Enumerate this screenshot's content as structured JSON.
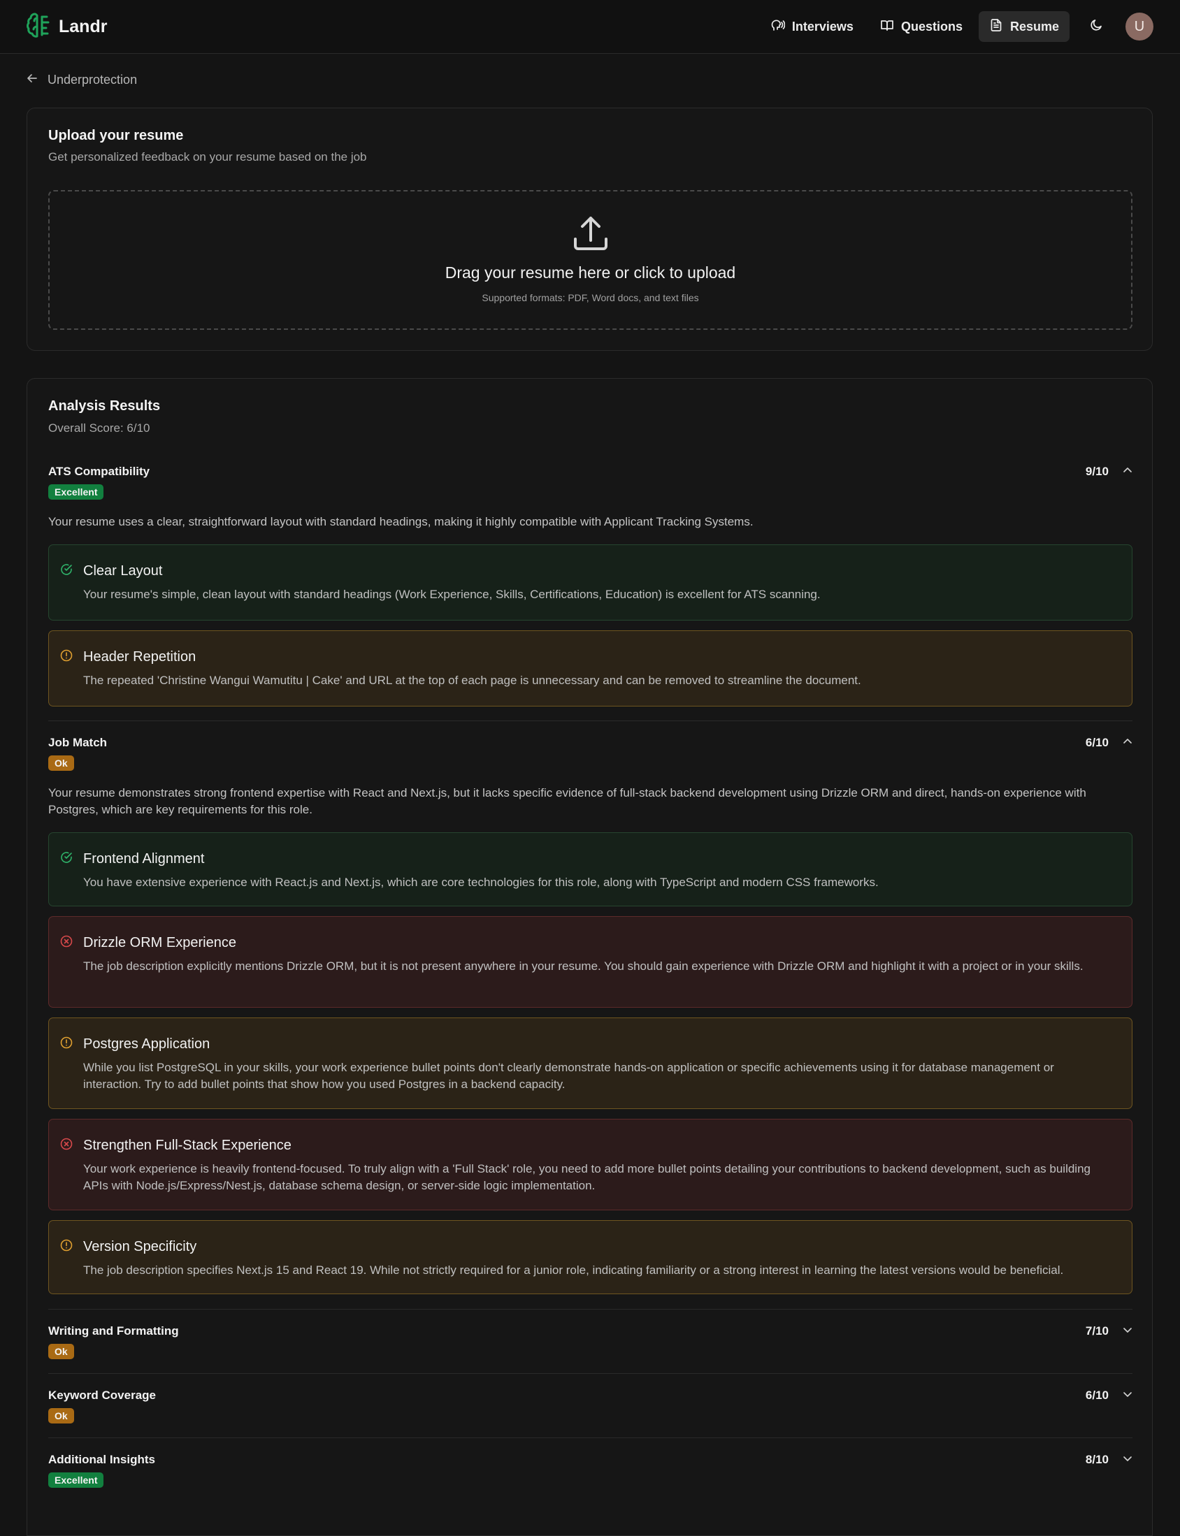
{
  "app": {
    "name": "Landr"
  },
  "nav": {
    "interviews": "Interviews",
    "questions": "Questions",
    "resume": "Resume",
    "avatar_initial": "U"
  },
  "back": {
    "label": "Underprotection"
  },
  "upload": {
    "title": "Upload your resume",
    "subtitle": "Get personalized feedback on your resume based on the job",
    "drop_title": "Drag your resume here or click to upload",
    "drop_sub": "Supported formats: PDF, Word docs, and text files"
  },
  "analysis": {
    "title": "Analysis Results",
    "overall": "Overall Score: 6/10",
    "sections": [
      {
        "name": "ATS Compatibility",
        "score": "9/10",
        "badge": "Excellent",
        "expanded": true,
        "description": "Your resume uses a clear, straightforward layout with standard headings, making it highly compatible with Applicant Tracking Systems.",
        "items": [
          {
            "type": "good",
            "title": "Clear Layout",
            "text": "Your resume's simple, clean layout with standard headings (Work Experience, Skills, Certifications, Education) is excellent for ATS scanning."
          },
          {
            "type": "warn",
            "title": "Header Repetition",
            "text": "The repeated 'Christine Wangui Wamutitu | Cake' and URL at the top of each page is unnecessary and can be removed to streamline the document."
          }
        ]
      },
      {
        "name": "Job Match",
        "score": "6/10",
        "badge": "Ok",
        "expanded": true,
        "description": "Your resume demonstrates strong frontend expertise with React and Next.js, but it lacks specific evidence of full-stack backend development using Drizzle ORM and direct, hands-on experience with Postgres, which are key requirements for this role.",
        "items": [
          {
            "type": "good",
            "title": "Frontend Alignment",
            "text": "You have extensive experience with React.js and Next.js, which are core technologies for this role, along with TypeScript and modern CSS frameworks."
          },
          {
            "type": "bad",
            "title": "Drizzle ORM Experience",
            "text": "The job description explicitly mentions Drizzle ORM, but it is not present anywhere in your resume. You should gain experience with Drizzle ORM and highlight it with a project or in your skills."
          },
          {
            "type": "warn",
            "title": "Postgres Application",
            "text": "While you list PostgreSQL in your skills, your work experience bullet points don't clearly demonstrate hands-on application or specific achievements using it for database management or interaction. Try to add bullet points that show how you used Postgres in a backend capacity."
          },
          {
            "type": "bad",
            "title": "Strengthen Full-Stack Experience",
            "text": "Your work experience is heavily frontend-focused. To truly align with a 'Full Stack' role, you need to add more bullet points detailing your contributions to backend development, such as building APIs with Node.js/Express/Nest.js, database schema design, or server-side logic implementation."
          },
          {
            "type": "warn",
            "title": "Version Specificity",
            "text": "The job description specifies Next.js 15 and React 19. While not strictly required for a junior role, indicating familiarity or a strong interest in learning the latest versions would be beneficial."
          }
        ]
      },
      {
        "name": "Writing and Formatting",
        "score": "7/10",
        "badge": "Ok",
        "expanded": false
      },
      {
        "name": "Keyword Coverage",
        "score": "6/10",
        "badge": "Ok",
        "expanded": false
      },
      {
        "name": "Additional Insights",
        "score": "8/10",
        "badge": "Excellent",
        "expanded": false
      }
    ]
  },
  "colors": {
    "excellent": "#12803f",
    "ok": "#a96a14",
    "good_icon": "#2fb36a",
    "warn_icon": "#e0a030",
    "bad_icon": "#d8494b"
  }
}
